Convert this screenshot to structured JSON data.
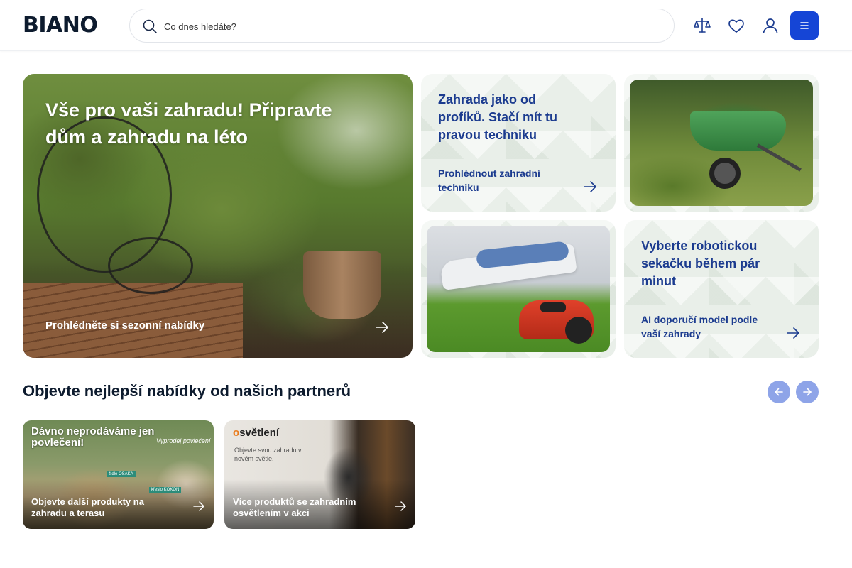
{
  "header": {
    "logo": "BIANO",
    "search_placeholder": "Co dnes hledáte?",
    "icons": [
      "compare-icon",
      "heart-icon",
      "user-icon",
      "menu-icon"
    ]
  },
  "hero": {
    "title": "Vše pro vaši zahradu! Připravte dům a zahradu na léto",
    "link": "Prohlédněte si sezonní nabídky"
  },
  "tiles": {
    "garden_tech": {
      "title": "Zahrada jako od profíků. Stačí mít tu pravou techniku",
      "link": "Prohlédnout zahradní techniku"
    },
    "robot_mower": {
      "title": "Vyberte robotickou sekačku během pár minut",
      "link": "AI doporučí model podle vaší zahrady"
    }
  },
  "partners": {
    "title": "Objevte nejlepší nabídky od našich partnerů",
    "cards": [
      {
        "headline": "Dávno neprodáváme jen povlečení!",
        "script": "Vyprodej povlečení",
        "tag1": "židle OSAKA",
        "tag2": "křeslo KOKON",
        "label": "Objevte další produkty na zahradu a terasu"
      },
      {
        "brand_o": "o",
        "brand_rest": "světlení",
        "sub": "Objevte svou zahradu v novém světle.",
        "label": "Více produktů se zahradním osvětlením v akci"
      }
    ]
  },
  "colors": {
    "accent": "#1545d6",
    "tile_text": "#1b3b8f",
    "tile_bg": "#e9efe9",
    "nav_btn": "#8ea4e8"
  }
}
